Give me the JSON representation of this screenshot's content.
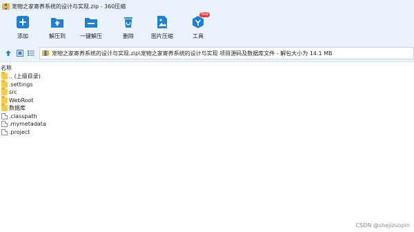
{
  "window": {
    "title": "宠物之家寄养系统的设计与实现.zip - 360压缩"
  },
  "toolbar": {
    "items": [
      {
        "label": "添加",
        "icon": "add-icon"
      },
      {
        "label": "解压到",
        "icon": "extract-to-icon"
      },
      {
        "label": "一键解压",
        "icon": "one-click-extract-icon"
      },
      {
        "label": "删除",
        "icon": "delete-icon"
      },
      {
        "label": "图片压缩",
        "icon": "image-compress-icon"
      },
      {
        "label": "工具",
        "icon": "tools-icon",
        "badge": "New"
      }
    ]
  },
  "address": {
    "path": "宠物之家寄养系统的设计与实现.zip\\宠物之家寄养系统的设计与实现 项目源码及数据库文件 - 解包大小为 14.1 MB"
  },
  "columns": {
    "name": "名称"
  },
  "files": [
    {
      "name": ".. (上级目录)",
      "type": "folder"
    },
    {
      "name": ".settings",
      "type": "folder"
    },
    {
      "name": "src",
      "type": "folder"
    },
    {
      "name": "WebRoot",
      "type": "folder"
    },
    {
      "name": "数据库",
      "type": "folder"
    },
    {
      "name": ".classpath",
      "type": "file"
    },
    {
      "name": ".mymetadata",
      "type": "file"
    },
    {
      "name": ".project",
      "type": "file"
    }
  ],
  "watermark": "CSDN @shejizuopin",
  "colors": {
    "accent": "#1e7fd6",
    "toolbar_bg": "#eaf3fc",
    "folder": "#f7cb4d"
  }
}
